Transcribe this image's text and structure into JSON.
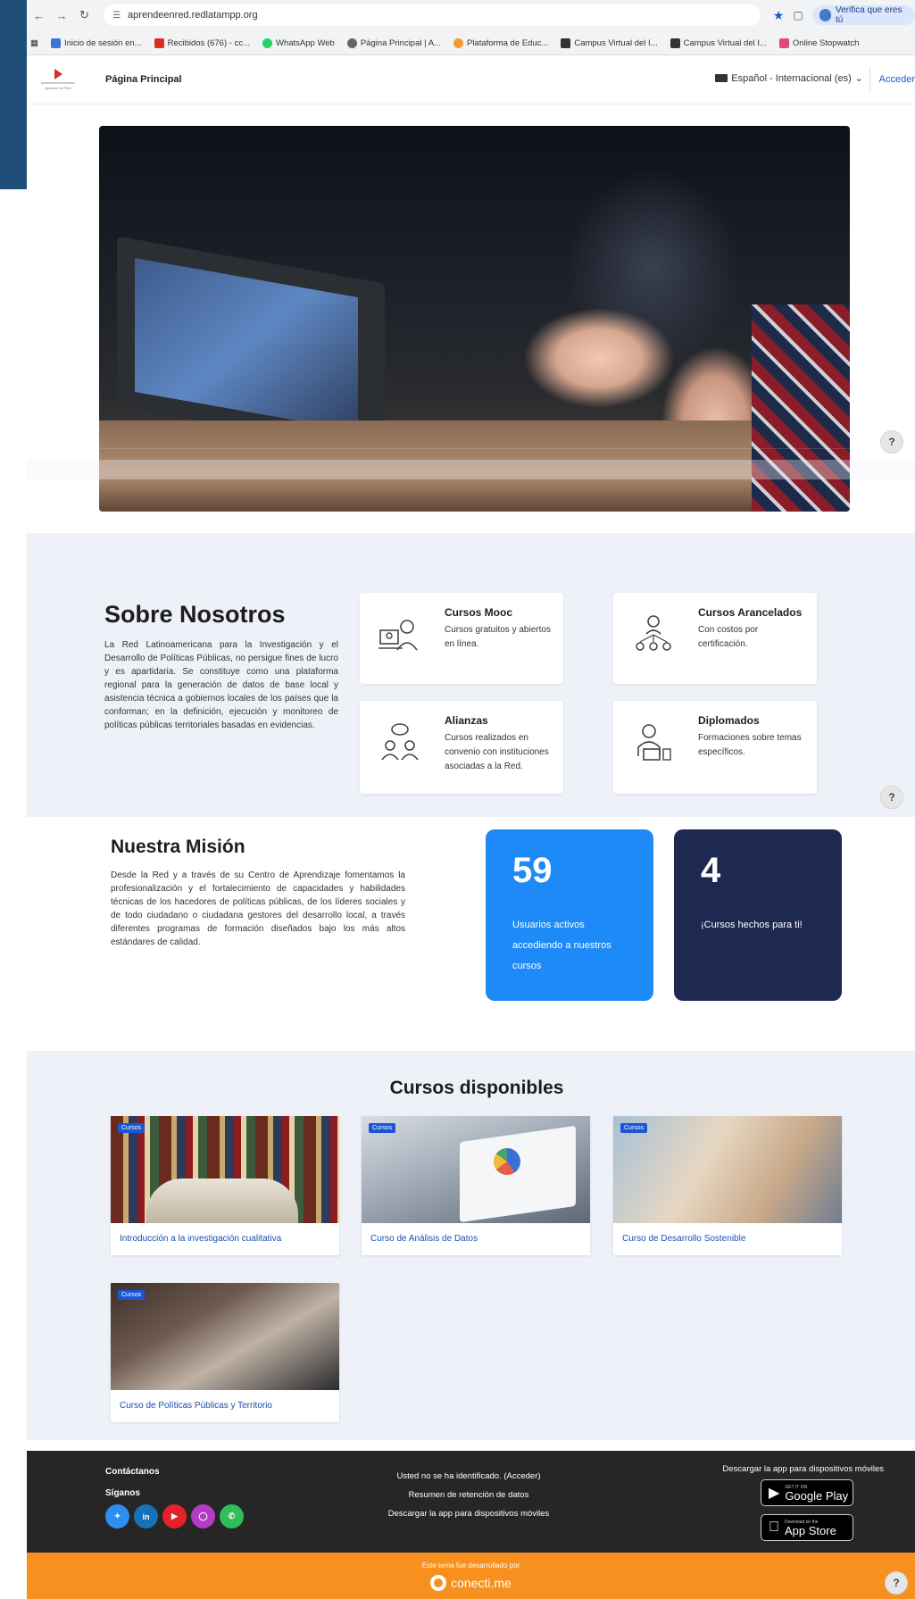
{
  "browser": {
    "url": "aprendeenred.redlatampp.org",
    "profile": "Verifica que eres tú",
    "bookmarks": [
      {
        "label": "Inicio de sesión en..."
      },
      {
        "label": "Recibidos (676) - cc..."
      },
      {
        "label": "WhatsApp Web"
      },
      {
        "label": "Página Principal | A..."
      },
      {
        "label": "Plataforma de Educ..."
      },
      {
        "label": "Campus Virtual del I..."
      },
      {
        "label": "Campus Virtual del I..."
      },
      {
        "label": "Online Stopwatch"
      }
    ]
  },
  "header": {
    "home": "Página Principal",
    "language": "Español - Internacional (es)",
    "login": "Acceder",
    "logo_text": "Aprende en Red"
  },
  "help_label": "?",
  "about": {
    "title": "Sobre Nosotros",
    "text": "La Red Latinoamericana para la Investigación y el Desarrollo de Políticas Públicas, no persigue fines de lucro y es apartidaria. Se constituye como una plataforma regional para la generación de datos de base local y asistencia técnica a gobiernos locales de los países que la conforman; en la definición, ejecución y monitoreo de políticas públicas territoriales basadas en evidencias.",
    "cards": [
      {
        "title": "Cursos Mooc",
        "desc": "Cursos gratuitos y abiertos en línea.",
        "icon": "online-teacher-icon"
      },
      {
        "title": "Cursos Arancelados",
        "desc": "Con costos por certificación.",
        "icon": "group-network-icon"
      },
      {
        "title": "Alianzas",
        "desc": "Cursos realizados en convenio con instituciones asociadas a la Red.",
        "icon": "people-chat-icon"
      },
      {
        "title": "Diplomados",
        "desc": "Formaciones sobre temas específicos.",
        "icon": "student-laptop-icon"
      }
    ]
  },
  "mission": {
    "title": "Nuestra Misión",
    "text": "Desde la Red y a través de su Centro de Aprendizaje fomentamos la profesionalización y el fortalecimiento de capacidades y habilidades técnicas de los hacedores de políticas públicas, de los líderes sociales y de todo ciudadano o ciudadana gestores del desarrollo local, a través diferentes programas de formación diseñados bajo los más altos estándares de calidad.",
    "stats": [
      {
        "value": "59",
        "label": "Usuarios activos accediendo a nuestros cursos",
        "color": "#1e8af7"
      },
      {
        "value": "4",
        "label": "¡Cursos hechos para ti!",
        "color": "#1d2951"
      }
    ]
  },
  "courses": {
    "title": "Cursos disponibles",
    "badge": "Cursos",
    "items": [
      {
        "name": "Introducción a la investigación cualitativa"
      },
      {
        "name": "Curso de Análisis de Datos"
      },
      {
        "name": "Curso de Desarrollo Sostenible"
      },
      {
        "name": "Curso de Políticas Públicas y Territorio"
      }
    ]
  },
  "footer": {
    "contact": "Contáctanos",
    "follow": "Síganos",
    "not_logged": "Usted no se ha identificado. (Acceder)",
    "retention": "Resumen de retención de datos",
    "app_mid": "Descargar la app para dispositivos móviles",
    "app_right": "Descargar la app para dispositivos móviles",
    "google_small": "GET IT ON",
    "google_big": "Google Play",
    "apple_small": "Download on the",
    "apple_big": "App Store",
    "theme_by": "Este tema fue desarrollado por",
    "brand": "conecti.me"
  },
  "colors": {
    "accent": "#1a56d6",
    "footer_bg": "#262626",
    "footer_orange": "#f7901e"
  }
}
